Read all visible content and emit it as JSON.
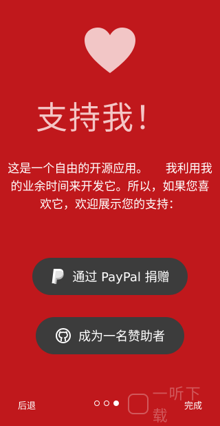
{
  "hero": {
    "icon": "heart-icon",
    "icon_color": "#f2c6c6"
  },
  "title": "支持我！",
  "body": "这是一个自由的开源应用。　　我利用我的业余时间来开发它。所以，如果您喜欢它，欢迎展示您的支持：",
  "buttons": {
    "paypal_label": "通过 PayPal 捐赠",
    "paypal_icon": "paypal-icon",
    "sponsor_label": "成为一名赞助者",
    "sponsor_icon": "github-icon"
  },
  "footer": {
    "back_label": "后退",
    "done_label": "完成",
    "page_count": 3,
    "current_page": 3
  },
  "watermark": {
    "text": "一听下载"
  },
  "colors": {
    "background": "#c0181c",
    "button": "#3c3c3c",
    "title": "#f4c6c6"
  }
}
